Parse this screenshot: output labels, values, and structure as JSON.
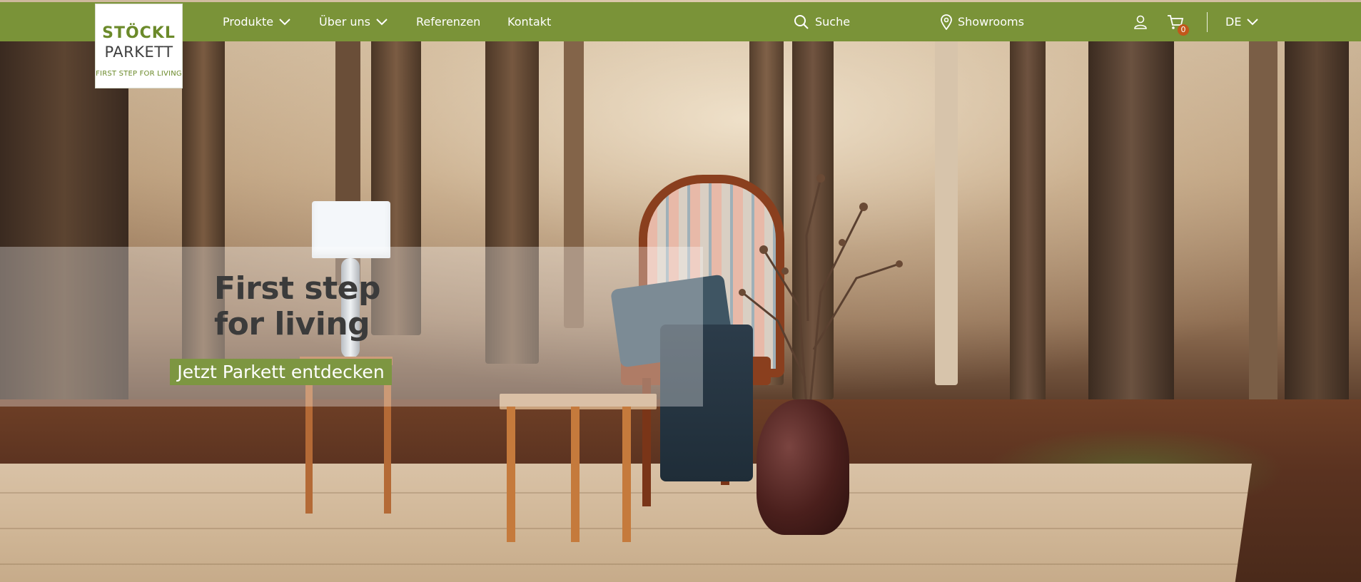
{
  "brand": {
    "line1": "STÖCKL",
    "line2": "PARKETT",
    "tagline": "FIRST STEP FOR LIVING",
    "accent_color": "#7a9338"
  },
  "nav": {
    "products": "Produkte",
    "about": "Über uns",
    "references": "Referenzen",
    "contact": "Kontakt"
  },
  "utility": {
    "search_label": "Suche",
    "showrooms_label": "Showrooms",
    "cart_count": "0",
    "language": "DE"
  },
  "hero": {
    "title_line1": "First step",
    "title_line2": "for living",
    "cta_label": "Jetzt Parkett entdecken"
  },
  "icons": {
    "search": "search-icon",
    "location": "map-pin-icon",
    "account": "user-icon",
    "cart": "cart-icon",
    "dropdown": "chevron-down-icon"
  }
}
